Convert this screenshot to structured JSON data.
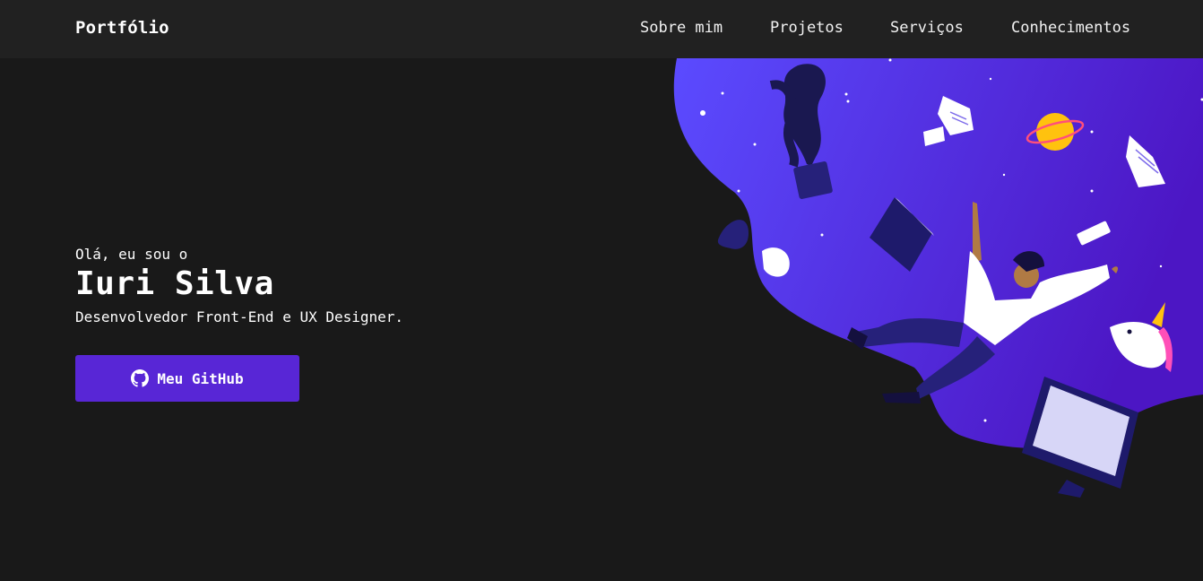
{
  "nav": {
    "brand": "Portfólio",
    "links": [
      "Sobre mim",
      "Projetos",
      "Serviços",
      "Conhecimentos"
    ]
  },
  "hero": {
    "greeting": "Olá, eu sou o",
    "name": "Iuri Silva",
    "role": "Desenvolvedor Front-End e UX Designer.",
    "button": {
      "label": "Meu GitHub",
      "icon": "github-icon"
    }
  },
  "illustration": {
    "subject": "person floating in space with plant pot, papers, planet, book, mug, unicorn and monitor",
    "colors": {
      "gradient_start": "#5b4bff",
      "gradient_end": "#4c16c4",
      "accent": "#5826d6"
    }
  }
}
